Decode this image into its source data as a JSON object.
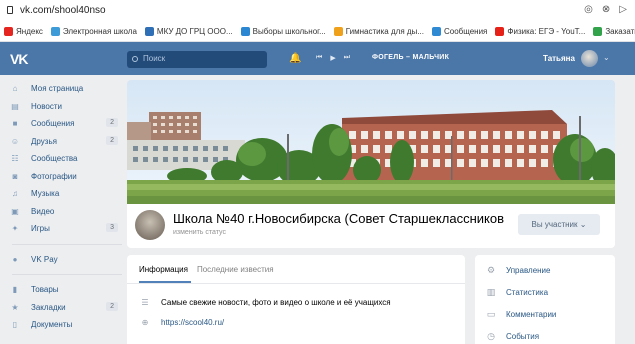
{
  "browser": {
    "url": "vk.com/shool40nso",
    "bookmarks": [
      {
        "label": "Яндекс",
        "icon": "yandex-icon",
        "color": "#e52620"
      },
      {
        "label": "Электронная школа",
        "icon": "school-icon",
        "color": "#3d9bd8"
      },
      {
        "label": "МКУ ДО ГРЦ ООО...",
        "icon": "globe-icon",
        "color": "#2f6fb5"
      },
      {
        "label": "Выборы школьног...",
        "icon": "vote-icon",
        "color": "#2b87d1"
      },
      {
        "label": "Гимнастика для ды...",
        "icon": "gym-icon",
        "color": "#f0a11b"
      },
      {
        "label": "Сообщения",
        "icon": "messages-icon",
        "color": "#2f8ad3"
      },
      {
        "label": "Физика: ЕГЭ - YouT...",
        "icon": "youtube-icon",
        "color": "#e62117"
      },
      {
        "label": "Заказать то",
        "icon": "check-icon",
        "color": "#33a34b"
      }
    ]
  },
  "header": {
    "logo": "VK",
    "search_placeholder": "Поиск",
    "now_playing": "ФОГЕЛЬ – МАЛЬЧИК",
    "user_name": "Татьяна"
  },
  "menu": {
    "items": [
      {
        "label": "Моя страница",
        "icon": "home-icon",
        "count": ""
      },
      {
        "label": "Новости",
        "icon": "news-icon",
        "count": ""
      },
      {
        "label": "Сообщения",
        "icon": "messages-icon",
        "count": "2"
      },
      {
        "label": "Друзья",
        "icon": "friends-icon",
        "count": "2"
      },
      {
        "label": "Сообщества",
        "icon": "groups-icon",
        "count": ""
      },
      {
        "label": "Фотографии",
        "icon": "photo-icon",
        "count": ""
      },
      {
        "label": "Музыка",
        "icon": "music-icon",
        "count": ""
      },
      {
        "label": "Видео",
        "icon": "video-icon",
        "count": ""
      },
      {
        "label": "Игры",
        "icon": "games-icon",
        "count": "3"
      }
    ],
    "items2": [
      {
        "label": "VK Pay",
        "icon": "vkpay-icon",
        "count": ""
      }
    ],
    "items3": [
      {
        "label": "Товары",
        "icon": "goods-icon",
        "count": ""
      },
      {
        "label": "Закладки",
        "icon": "bookmark-icon",
        "count": "2"
      },
      {
        "label": "Документы",
        "icon": "documents-icon",
        "count": ""
      }
    ]
  },
  "group": {
    "title": "Школа №40 г.Новосибирска (Совет Старшеклассников",
    "status": "изменить статус",
    "member_button": "Вы участник ⌄"
  },
  "info": {
    "tabs": [
      "Информация",
      "Последние известия"
    ],
    "description": "Самые свежие новости, фото и видео о школе и её учащихся",
    "link": "https://scool40.ru/"
  },
  "actions": [
    {
      "label": "Управление",
      "icon": "gear-icon"
    },
    {
      "label": "Статистика",
      "icon": "stats-icon"
    },
    {
      "label": "Комментарии",
      "icon": "comments-icon"
    },
    {
      "label": "События",
      "icon": "events-icon"
    }
  ]
}
